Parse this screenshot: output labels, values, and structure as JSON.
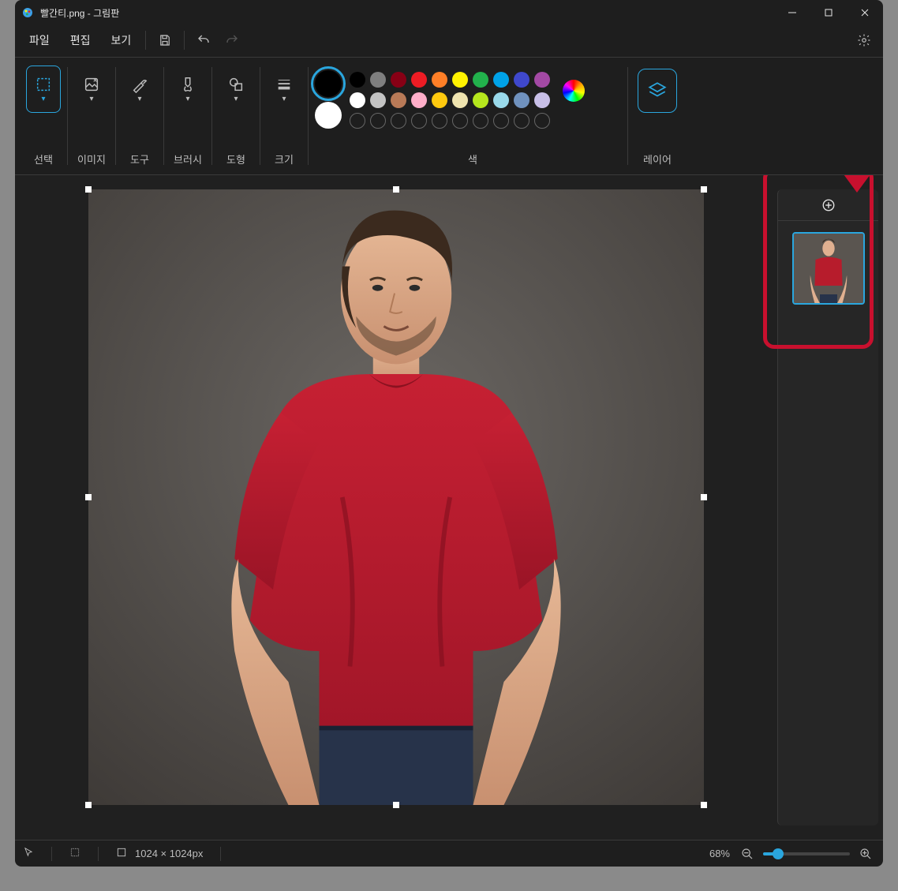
{
  "title": "빨간티.png - 그림판",
  "menu": {
    "file": "파일",
    "edit": "편집",
    "view": "보기"
  },
  "ribbon": {
    "select": "선택",
    "image": "이미지",
    "tool": "도구",
    "brush": "브러시",
    "shape": "도형",
    "size": "크기",
    "color": "색",
    "layer": "레이어"
  },
  "colors": {
    "primary": "#000000",
    "secondary": "#ffffff",
    "row1": [
      "#000000",
      "#7f7f7f",
      "#880015",
      "#ed1c24",
      "#ff7f27",
      "#fff200",
      "#22b14c",
      "#00a2e8",
      "#3f48cc",
      "#a349a4"
    ],
    "row2": [
      "#ffffff",
      "#c3c3c3",
      "#b97a57",
      "#ffaec9",
      "#ffc90e",
      "#efe4b0",
      "#b5e61d",
      "#99d9ea",
      "#7092be",
      "#c8bfe7"
    ]
  },
  "status": {
    "canvas_size": "1024 × 1024px",
    "zoom": "68%"
  }
}
